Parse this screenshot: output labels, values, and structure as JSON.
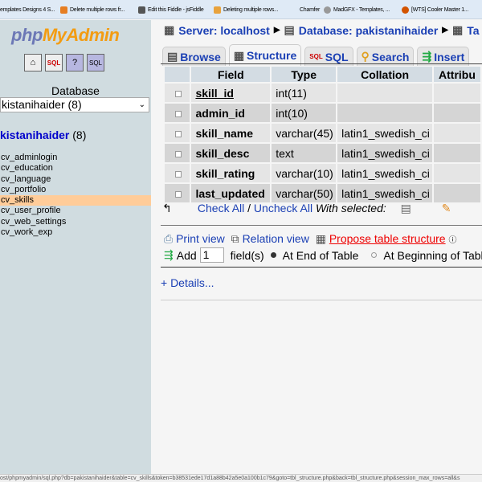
{
  "bookmarks": [
    "emplates Designs 4 S...",
    "Delete multiple rows fr...",
    "Edit this Fiddle - jsFiddle",
    "Deleting multiple rows...",
    "Chamfer",
    "MadGFX - Templates, ...",
    "[WTS] Cooler Master 1..."
  ],
  "sidebar": {
    "logo_a": "php",
    "logo_b": "MyAdmin",
    "icons": [
      "home-icon",
      "sql-window-icon",
      "help-icon",
      "sql-docs-icon"
    ],
    "db_label": "Database",
    "db_select": "kistanihaider (8)",
    "db_name": "kistanihaider",
    "db_count": "(8)",
    "tables": [
      "cv_adminlogin",
      "cv_education",
      "cv_language",
      "cv_portfolio",
      "cv_skills",
      "cv_user_profile",
      "cv_web_settings",
      "cv_work_exp"
    ],
    "selected": "cv_skills"
  },
  "breadcrumb": {
    "server": "Server: localhost",
    "database": "Database: pakistanihaider",
    "table": "Ta"
  },
  "tabs": [
    {
      "label": "Browse"
    },
    {
      "label": "Structure"
    },
    {
      "label": "SQL"
    },
    {
      "label": "Search"
    },
    {
      "label": "Insert"
    }
  ],
  "table": {
    "headers": [
      "Field",
      "Type",
      "Collation",
      "Attribu"
    ],
    "rows": [
      [
        "skill_id",
        "int(11)",
        ""
      ],
      [
        "admin_id",
        "int(10)",
        ""
      ],
      [
        "skill_name",
        "varchar(45)",
        "latin1_swedish_ci"
      ],
      [
        "skill_desc",
        "text",
        "latin1_swedish_ci"
      ],
      [
        "skill_rating",
        "varchar(10)",
        "latin1_swedish_ci"
      ],
      [
        "last_updated",
        "varchar(50)",
        "latin1_swedish_ci"
      ]
    ]
  },
  "actions": {
    "check_all": "Check All",
    "sep": "/",
    "uncheck_all": "Uncheck All",
    "with_selected": "With selected:"
  },
  "links": {
    "print": "Print view",
    "relation": "Relation view",
    "propose": "Propose table structure"
  },
  "add": {
    "label": "Add",
    "value": "1",
    "fields": "field(s)",
    "end": "At End of Table",
    "begin": "At Beginning of Tabl"
  },
  "details": "+ Details...",
  "status": "ost/phpmyadmin/sql.php?db=pakistanihaider&table=cv_skills&token=b38531ede17d1a88b42a5e0a100b1c79&goto=tbl_structure.php&back=tbl_structure.php&session_max_rows=all&s"
}
